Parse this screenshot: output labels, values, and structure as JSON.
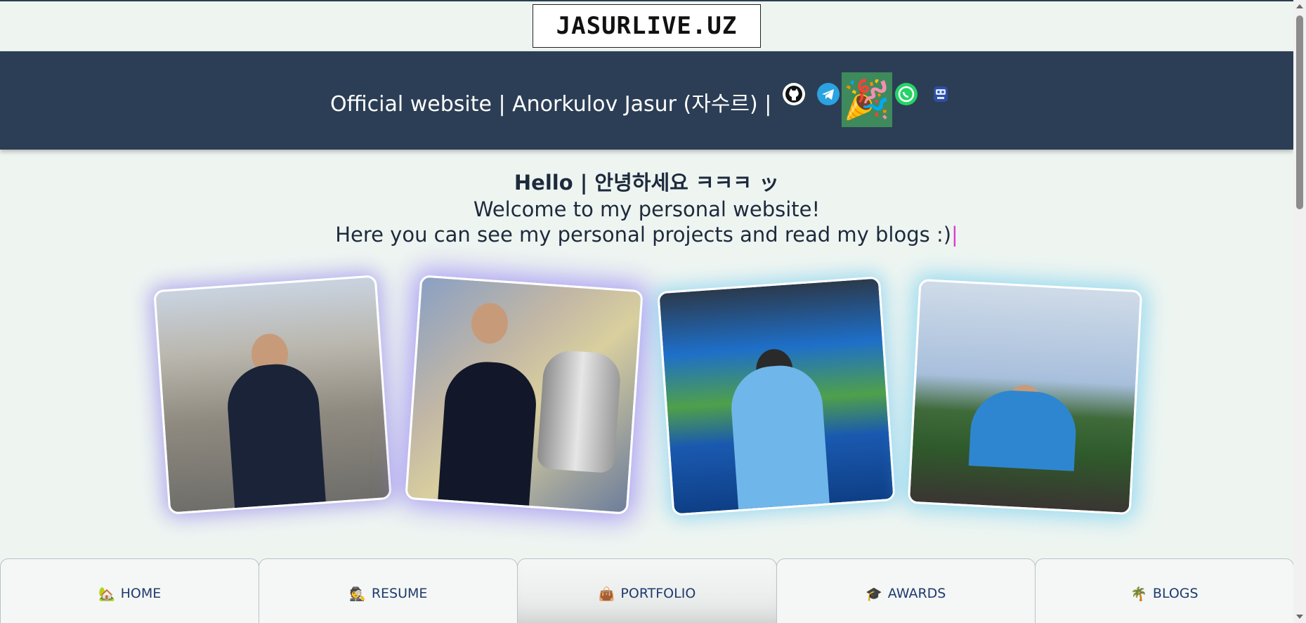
{
  "site": {
    "logo_text": "JASURLIVE.UZ"
  },
  "banner": {
    "text": "Official website | Anorkulov Jasur (자수르) |",
    "social_icons": [
      "github-icon",
      "telegram-icon",
      "party-popper-icon",
      "whatsapp-icon",
      "robot-icon"
    ],
    "party_emoji": "🎉"
  },
  "greeting": {
    "title": "Hello | 안녕하세요 ㅋㅋㅋ ッ",
    "line1": "Welcome to my personal website!",
    "line2": "Here you can see my personal projects and read my blogs :)",
    "caret": "|"
  },
  "colors": {
    "banner_bg": "#2c3e55",
    "page_bg": "#eef5f1",
    "nav_text": "#1e3a6e",
    "party_box": "#3f8a5c"
  },
  "nav": {
    "items": [
      {
        "icon": "🏡",
        "label": "HOME"
      },
      {
        "icon": "🕵️",
        "label": "RESUME"
      },
      {
        "icon": "👜",
        "label": "PORTFOLIO"
      },
      {
        "icon": "🎓",
        "label": "AWARDS"
      },
      {
        "icon": "🌴",
        "label": "BLOGS"
      }
    ],
    "active_index": 2
  }
}
